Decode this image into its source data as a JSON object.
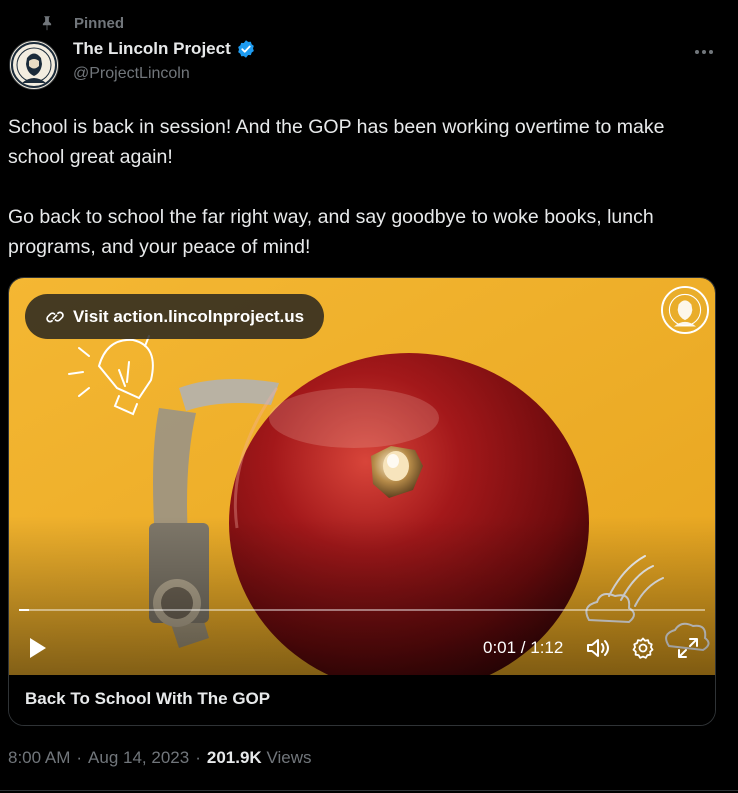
{
  "header": {
    "pinned_label": "Pinned",
    "display_name": "The Lincoln Project",
    "handle": "@ProjectLincoln",
    "icons": [
      "pin-icon",
      "verified-badge-icon",
      "more-icon"
    ]
  },
  "tweet": {
    "text": "School is back in session! And the GOP has been working overtime to make school great again!\n\nGo back to school the far right way, and say goodbye to woke books, lunch programs, and your peace of mind!"
  },
  "video": {
    "link_label": "Visit action.lincolnproject.us",
    "time_display": "0:01 / 1:12",
    "progress_fraction": 0.014,
    "title": "Back To School With The GOP",
    "controls": [
      "play-icon",
      "volume-icon",
      "settings-icon",
      "fullscreen-icon"
    ]
  },
  "meta": {
    "time": "8:00 AM",
    "separator": "·",
    "date": "Aug 14, 2023",
    "views_count": "201.9K",
    "views_label": "Views"
  },
  "colors": {
    "background": "#000000",
    "text_primary": "#e7e9ea",
    "text_secondary": "#71767b",
    "verified_blue": "#1d9bf0",
    "video_background": "#f0b12e",
    "bell_red": "#8e1414"
  }
}
